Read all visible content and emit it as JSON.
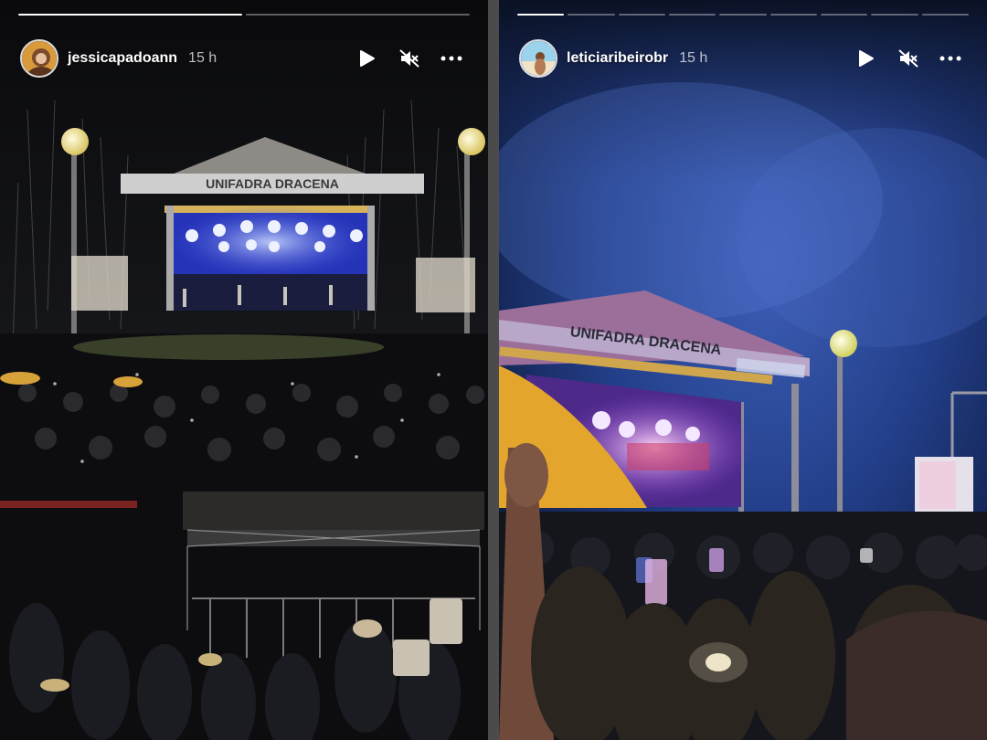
{
  "stories": [
    {
      "username": "jessicapadoann",
      "time": "15 h",
      "progress_segments": [
        1.0,
        0.0
      ],
      "stage_banner": "UNIFADRA DRACENA"
    },
    {
      "username": "leticiaribeirobr",
      "time": "15 h",
      "progress_segments": [
        1.0,
        0.0,
        0.0,
        0.0,
        0.0,
        0.0,
        0.0,
        0.0,
        0.0
      ],
      "stage_banner": "UNIFADRA DRACENA"
    }
  ],
  "icons": {
    "play": "play-icon",
    "mute": "speaker-muted-icon",
    "more": "more-options-icon"
  }
}
